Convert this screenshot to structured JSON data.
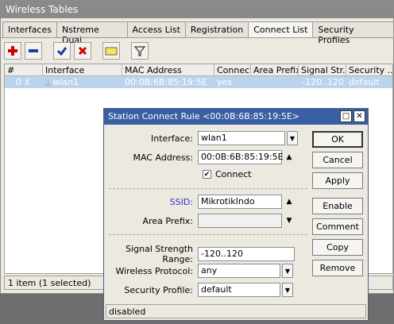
{
  "window": {
    "title": "Wireless Tables"
  },
  "tabs": [
    {
      "label": "Interfaces"
    },
    {
      "label": "Nstreme Dual"
    },
    {
      "label": "Access List"
    },
    {
      "label": "Registration"
    },
    {
      "label": "Connect List"
    },
    {
      "label": "Security Profiles"
    }
  ],
  "toolbar": {
    "icons": [
      "add-icon",
      "remove-icon",
      "enable-icon",
      "disable-icon",
      "comment-icon",
      "filter-icon"
    ],
    "colors": {
      "add": "#d40000",
      "remove": "#1a3f9e",
      "enable": "#1a3f9e",
      "disable": "#d40000"
    }
  },
  "table": {
    "columns": [
      "#",
      "Interface",
      "MAC Address",
      "Connect",
      "Area Prefix",
      "Signal Str...",
      "Security ..."
    ],
    "rows": [
      {
        "num": "0",
        "flag": "X",
        "interface": "wlan1",
        "mac": "00:0B:6B:85:19:5E",
        "connect": "yes",
        "area_prefix": "",
        "signal": "-120..120",
        "security": "default"
      }
    ],
    "status": "1 item (1 selected)"
  },
  "dialog": {
    "title": "Station Connect Rule <00:0B:6B:85:19:5E>",
    "fields": {
      "interface_label": "Interface:",
      "interface_value": "wlan1",
      "mac_label": "MAC Address:",
      "mac_value": "00:0B:6B:85:19:5E",
      "connect_label": "Connect",
      "ssid_label": "SSID:",
      "ssid_value": "MikrotikIndo",
      "area_prefix_label": "Area Prefix:",
      "area_prefix_value": "",
      "signal_label": "Signal Strength Range:",
      "signal_value": "-120..120",
      "protocol_label": "Wireless Protocol:",
      "protocol_value": "any",
      "security_label": "Security Profile:",
      "security_value": "default"
    },
    "buttons": [
      "OK",
      "Cancel",
      "Apply",
      "Enable",
      "Comment",
      "Copy",
      "Remove"
    ],
    "status": "disabled",
    "ssid_color": "#2c35c8"
  }
}
